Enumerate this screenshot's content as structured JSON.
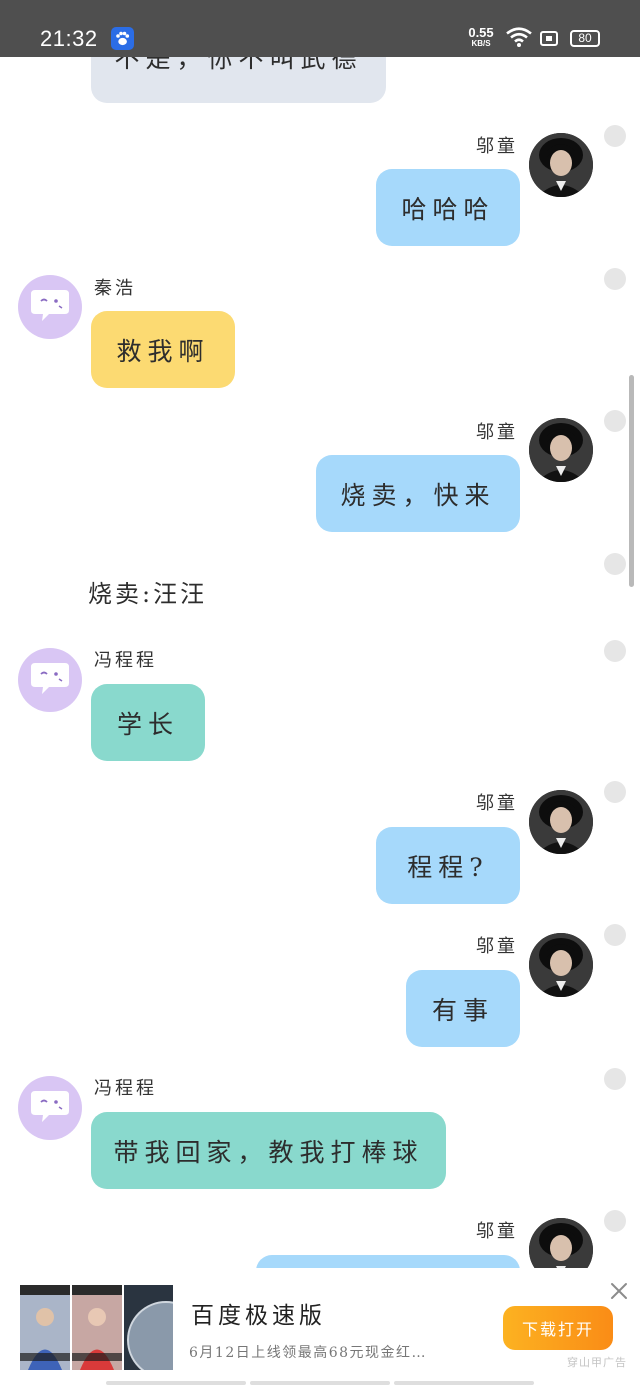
{
  "status_bar": {
    "time": "21:32",
    "net_speed_value": "0.55",
    "net_speed_unit": "KB/S",
    "battery": "80",
    "app_icon": "baidu-paw-icon"
  },
  "chat": {
    "messages": [
      {
        "sender": "",
        "text": "不是，你不叫武德",
        "side": "left",
        "color": "#e1e6ee"
      },
      {
        "sender": "邬童",
        "text": "哈哈哈",
        "side": "right",
        "color": "#a6d9fb"
      },
      {
        "sender": "秦浩",
        "text": "救我啊",
        "side": "left",
        "color": "#fcda72"
      },
      {
        "sender": "邬童",
        "text": "烧卖，快来",
        "side": "right",
        "color": "#a6d9fb"
      },
      {
        "narration": "烧卖:汪汪"
      },
      {
        "sender": "冯程程",
        "text": "学长",
        "side": "left",
        "color": "#89d9cd"
      },
      {
        "sender": "邬童",
        "text": "程程?",
        "side": "right",
        "color": "#a6d9fb"
      },
      {
        "sender": "邬童",
        "text": "有事",
        "side": "right",
        "color": "#a6d9fb"
      },
      {
        "sender": "冯程程",
        "text": "带我回家，教我打棒球",
        "side": "left",
        "color": "#89d9cd"
      },
      {
        "sender": "邬童",
        "text": "",
        "side": "right",
        "color": "#a6d9fb"
      }
    ]
  },
  "ad": {
    "title": "百度极速版",
    "description": "6月12日上线领最高68元现金红…",
    "button": "下载打开",
    "source": "穿山甲广告",
    "close_icon": "close-icon"
  }
}
